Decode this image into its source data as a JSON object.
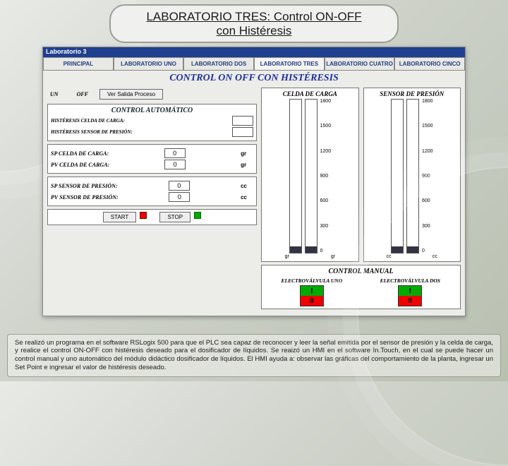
{
  "title_line1": "LABORATORIO TRES: Control ON-OFF",
  "title_line2": "con Histéresis",
  "hmi": {
    "window_title": "Laboratorio 3",
    "tabs": [
      "PRINCIPAL",
      "LABORATORIO UNO",
      "LABORATORIO DOS",
      "LABORATORIO TRES",
      "LABORATORIO CUATRO",
      "LABORATORIO CINCO"
    ],
    "active_tab": 3,
    "header": "CONTROL ON OFF CON HISTÉRESIS",
    "off_block": {
      "off": "OFF",
      "un": "UN",
      "ver_btn": "Ver Salida Proceso"
    },
    "auto": {
      "title": "CONTROL AUTOMÁTICO",
      "hist_celda": "HISTÉRESIS CELDA DE CARGA:",
      "hist_presion": "HISTÉRESIS SENSOR DE PRESIÓN:",
      "sp_celda_lbl": "SP CELDA DE CARGA:",
      "sp_celda_val": "0",
      "sp_celda_unit": "gr",
      "pv_celda_lbl": "PV CELDA DE CARGA:",
      "pv_celda_val": "0",
      "pv_celda_unit": "gr",
      "sp_pres_lbl": "SP SENSOR DE PRESIÓN:",
      "sp_pres_val": "0",
      "sp_pres_unit": "cc",
      "pv_pres_lbl": "PV SENSOR DE PRESIÓN:",
      "pv_pres_val": "0",
      "pv_pres_unit": "cc",
      "start": "START",
      "stop": "STOP"
    },
    "gauges": {
      "celda_title": "CELDA DE CARGA",
      "presion_title": "SENSOR DE PRESIÓN",
      "ticks": [
        "1800",
        "1500",
        "1200",
        "900",
        "600",
        "300",
        "0"
      ],
      "base_left_a": "gr",
      "base_left_b": "gr",
      "base_right_a": "cc",
      "base_right_b": "cc"
    },
    "manual": {
      "title": "CONTROL MANUAL",
      "valve1": "ELECTROVÁLVULA UNO",
      "valve2": "ELECTROVÁLVULA DOS",
      "on": "I",
      "off": "0"
    }
  },
  "caption": "Se realizó un programa en el software RSLogix 500 para que el PLC sea capaz de reconocer y leer la señal emitida por el sensor de presión y la celda de carga, y realice el control ON-OFF con histéresis deseado para el dosificador de líquidos. Se reaizó un HMI en el software In.Touch, en el cual se puede hacer un control manual y uno automático del módulo didáctico dosificador de líquidos. El HMI ayuda a: observar las gráficas del comportamiento de la planta, ingresar un Set Point e ingresar el valor de histéresis deseado."
}
